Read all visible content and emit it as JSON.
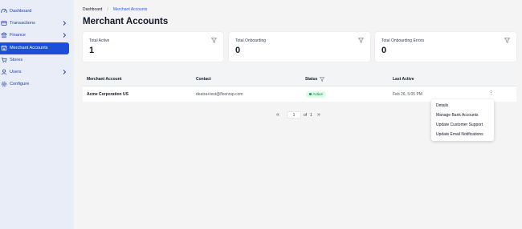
{
  "sidebar": {
    "items": [
      {
        "label": "Dashboard",
        "icon": "gauge-icon",
        "has_chevron": false,
        "active": false
      },
      {
        "label": "Transactions",
        "icon": "transactions-icon",
        "has_chevron": true,
        "active": false
      },
      {
        "label": "Finance",
        "icon": "bank-icon",
        "has_chevron": true,
        "active": false
      },
      {
        "label": "Merchant Accounts",
        "icon": "storefront-icon",
        "has_chevron": false,
        "active": true
      },
      {
        "label": "Stores",
        "icon": "cart-icon",
        "has_chevron": false,
        "active": false
      },
      {
        "label": "Users",
        "icon": "user-icon",
        "has_chevron": true,
        "active": false
      },
      {
        "label": "Configure",
        "icon": "gear-icon",
        "has_chevron": false,
        "active": false
      }
    ]
  },
  "breadcrumb": {
    "home": "Dashboard",
    "separator": "/",
    "current": "Merchant Accounts"
  },
  "page": {
    "title": "Merchant Accounts"
  },
  "stats": [
    {
      "label": "Total Active",
      "value": "1"
    },
    {
      "label": "Total Onboarding",
      "value": "0"
    },
    {
      "label": "Total Onboarding Errors",
      "value": "0"
    }
  ],
  "table": {
    "headers": {
      "merchant": "Merchant Account",
      "contact": "Contact",
      "status": "Status",
      "last_active": "Last Active"
    },
    "rows": [
      {
        "merchant": "Acme Corporation US",
        "contact": "deatra+test@floorzsp.com",
        "status": "Active",
        "last_active": "Feb 26, 5:05 PM"
      }
    ]
  },
  "pagination": {
    "current_page": "1",
    "of_label": "of",
    "total_pages": "1",
    "first": "«",
    "last": "»"
  },
  "row_menu": {
    "items": [
      "Details",
      "Manage Bank Accounts",
      "Update Customer Support",
      "Update Email Notifications"
    ]
  },
  "colors": {
    "accent": "#1d4ed8",
    "sidebar_bg": "#e8edf8",
    "success_bg": "#dcfce7",
    "success_text": "#15803d"
  }
}
